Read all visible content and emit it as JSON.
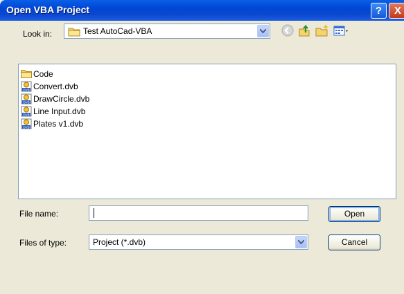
{
  "window": {
    "title": "Open VBA Project",
    "help_glyph": "?",
    "close_glyph": "X"
  },
  "lookin": {
    "label": "Look in:",
    "value": "Test AutoCad-VBA"
  },
  "toolbar": {
    "icons": [
      "back-icon",
      "up-folder-icon",
      "new-folder-icon",
      "views-menu-icon"
    ]
  },
  "files": [
    {
      "name": "Code",
      "icon": "folder-icon"
    },
    {
      "name": "Convert.dvb",
      "icon": "dvb-file-icon"
    },
    {
      "name": "DrawCircle.dvb",
      "icon": "dvb-file-icon"
    },
    {
      "name": "Line Input.dvb",
      "icon": "dvb-file-icon"
    },
    {
      "name": "Plates v1.dvb",
      "icon": "dvb-file-icon"
    }
  ],
  "filename": {
    "label": "File name:",
    "value": ""
  },
  "filetype": {
    "label": "Files of type:",
    "value": "Project (*.dvb)"
  },
  "buttons": {
    "open": "Open",
    "cancel": "Cancel"
  },
  "colors": {
    "titlebar": "#0a48d0",
    "dialog_bg": "#ece9d8",
    "close_red": "#c1391c"
  }
}
